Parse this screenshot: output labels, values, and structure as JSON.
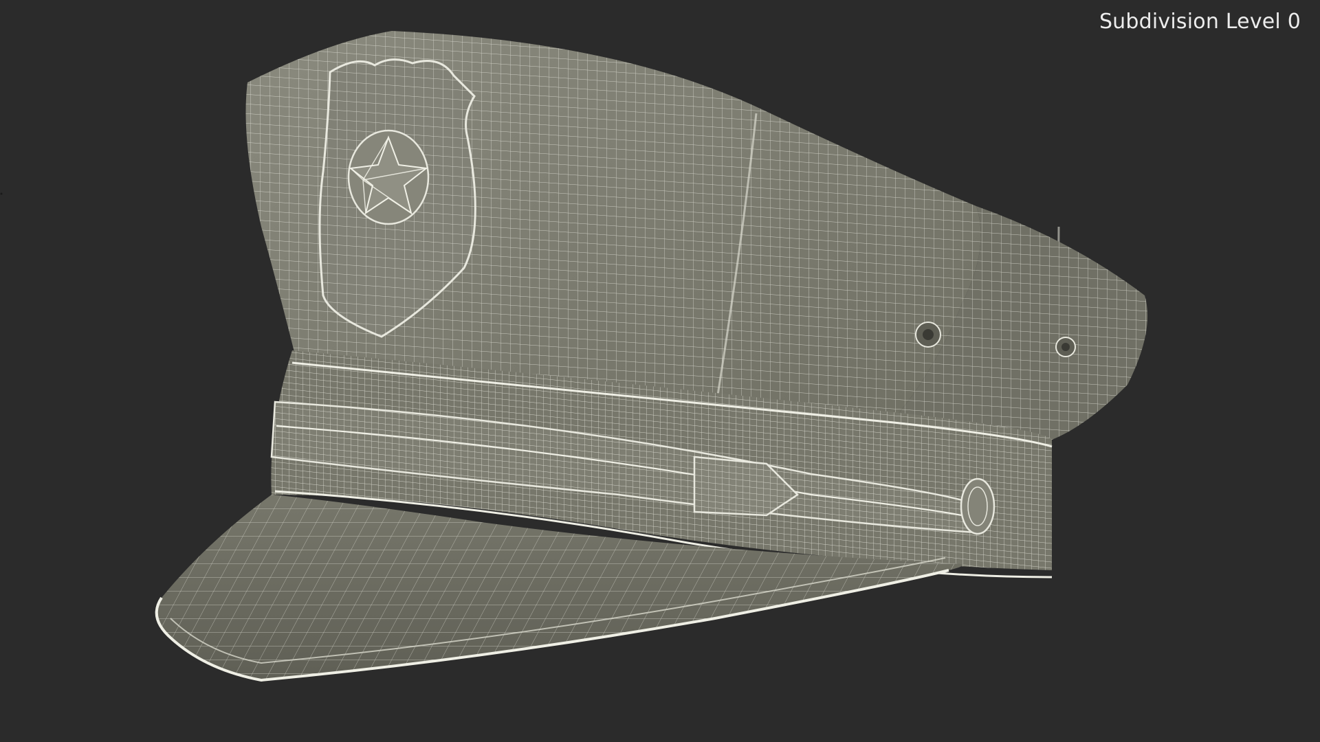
{
  "viewport": {
    "label": "Subdivision Level 0",
    "background": "#2b2b2b"
  },
  "model": {
    "subject": "police-cap-wireframe",
    "surface_color": "#7a7a6e",
    "wire_color": "#e8e8de"
  }
}
